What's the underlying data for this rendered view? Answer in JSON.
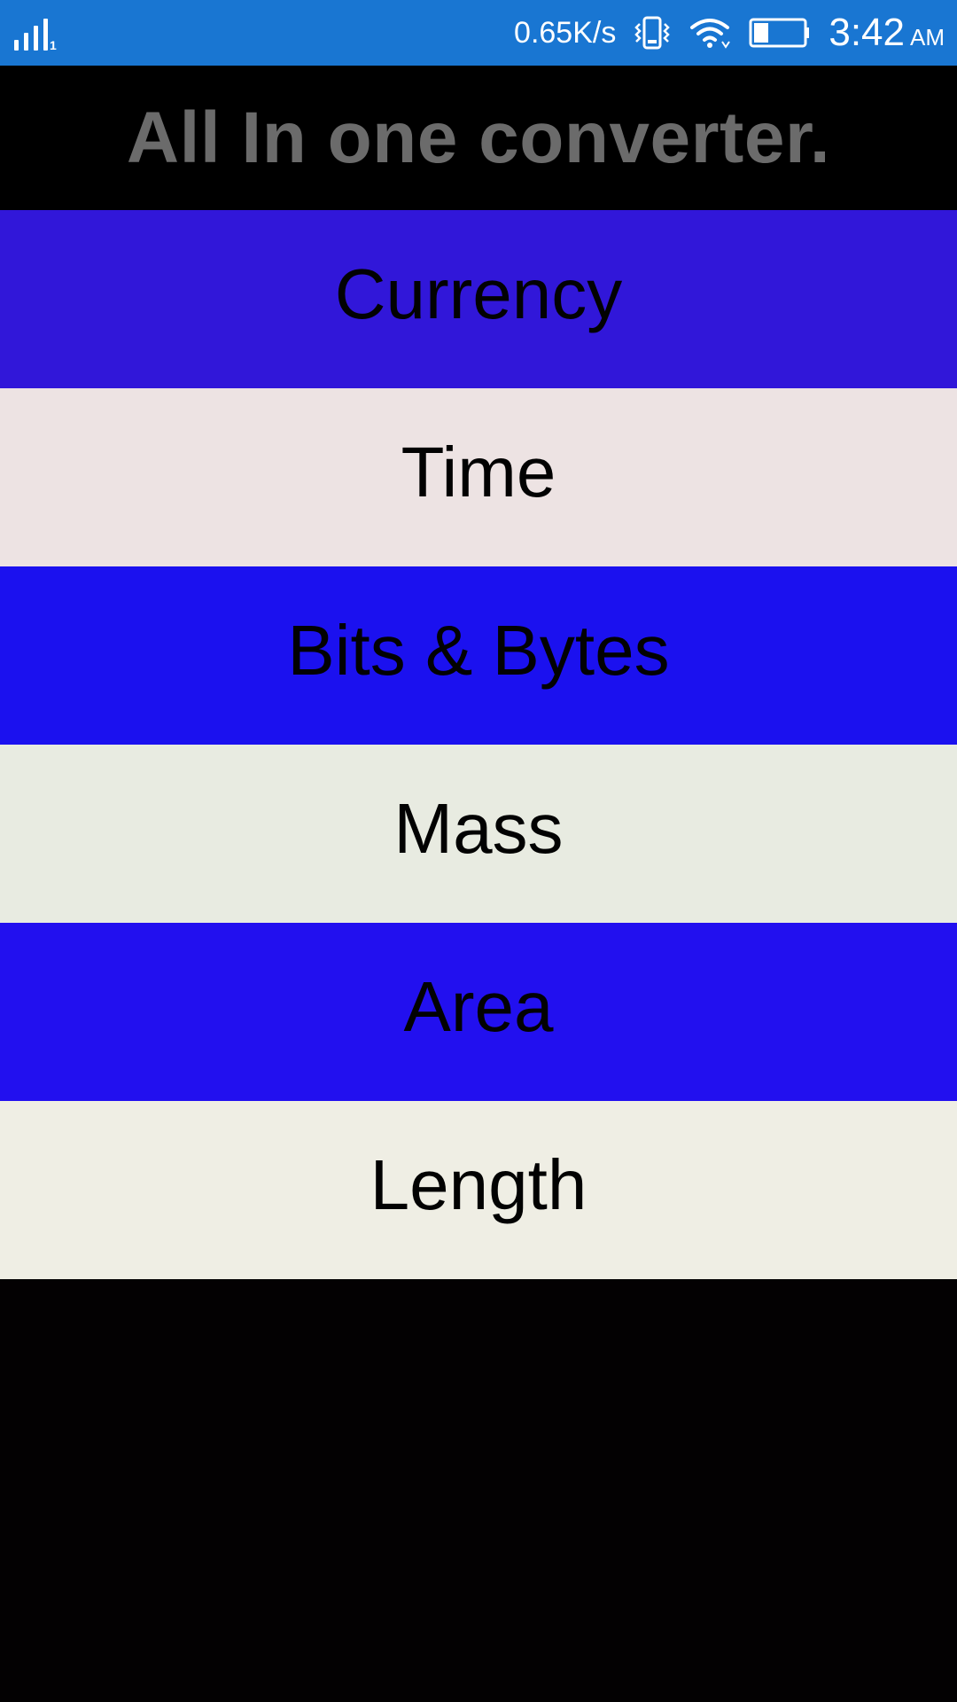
{
  "status_bar": {
    "signal_sub": "1",
    "net_speed": "0.65K/s",
    "time": "3:42",
    "ampm": "AM",
    "icons": [
      "signal-icon",
      "vibrate-icon",
      "wifi-icon",
      "battery-icon"
    ],
    "battery_level": 0.3
  },
  "header": {
    "title": "All In one converter."
  },
  "menu": {
    "items": [
      {
        "label": "Currency",
        "color": "#3117d9"
      },
      {
        "label": "Time",
        "color": "#ede3e3"
      },
      {
        "label": "Bits & Bytes",
        "color": "#1b11ef"
      },
      {
        "label": "Mass",
        "color": "#e8ebe1"
      },
      {
        "label": "Area",
        "color": "#2210ef"
      },
      {
        "label": "Length",
        "color": "#efeee4"
      }
    ]
  },
  "colors": {
    "status_bar": "#1976d2",
    "header_bg": "#000000",
    "title_text": "#6b6b6b",
    "page_bg": "#030102"
  }
}
